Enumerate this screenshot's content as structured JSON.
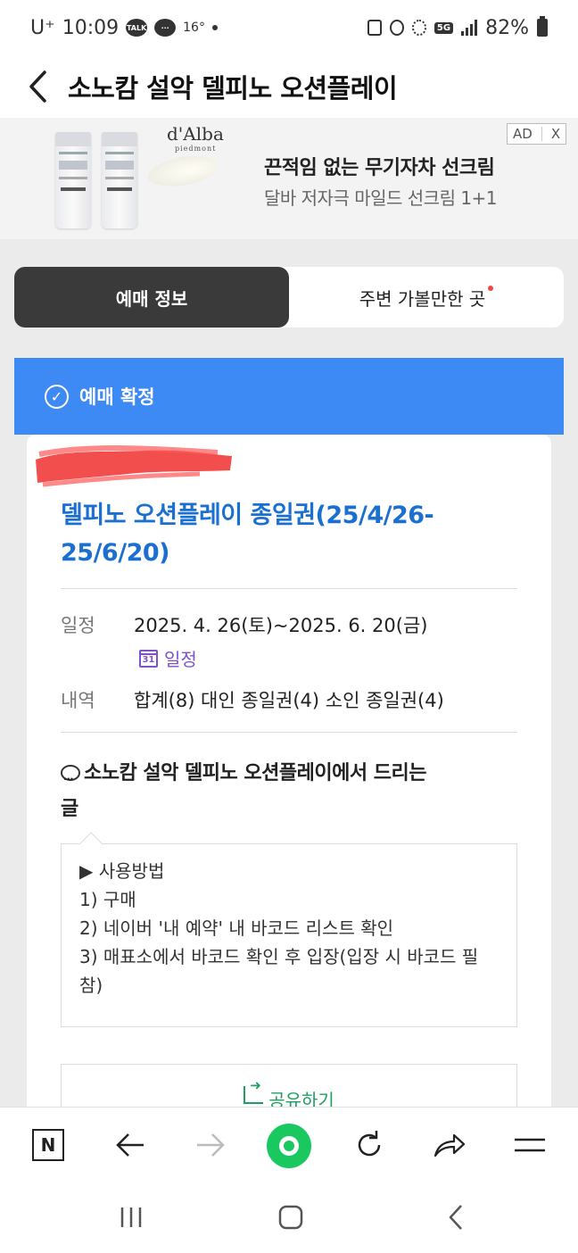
{
  "status_bar": {
    "carrier": "U⁺",
    "time": "10:09",
    "talk_badge": "TALK",
    "temperature": "16°",
    "network": "5G",
    "battery": "82%"
  },
  "header": {
    "title": "소노캄 설악 델피노 오션플레이"
  },
  "ad": {
    "brand": "d'Alba",
    "brand_sub": "piedmont",
    "headline": "끈적임 없는 무기자차 선크림",
    "subline": "달바 저자극 마일드 선크림 1+1",
    "badge_label": "AD",
    "close_label": "X"
  },
  "tabs": [
    {
      "label": "예매 정보",
      "active": true
    },
    {
      "label": "주변 가볼만한 곳",
      "active": false,
      "has_dot": true
    }
  ],
  "booking": {
    "status_label": "예매 확정",
    "product_title_line1": "델피노 오션플레이 종일권(25/4/26-",
    "product_title_line2": "25/6/20)",
    "schedule_label": "일정",
    "schedule_value": "2025. 4. 26(토)~2025. 6. 20(금)",
    "calendar_icon_text": "31",
    "calendar_link_label": "일정",
    "detail_label": "내역",
    "detail_value": "합계(8) 대인 종일권(4) 소인 종일권(4)"
  },
  "message": {
    "heading_line1": "소노캄 설악 델피노 오션플레이에서 드리는",
    "heading_line2": "글",
    "lines": [
      "▶ 사용방법",
      "1) 구매",
      "2) 네이버 '내 예약' 내 바코드 리스트 확인",
      "3) 매표소에서 바코드 확인 후 입장(입장 시 바코드 필참)"
    ]
  },
  "share": {
    "label": "공유하기"
  },
  "browser_bar": {
    "n_label": "N"
  },
  "colors": {
    "accent_blue": "#3d8af5",
    "title_blue": "#1b6fd0",
    "green": "#19c95f",
    "calendar_purple": "#7d52c8"
  }
}
